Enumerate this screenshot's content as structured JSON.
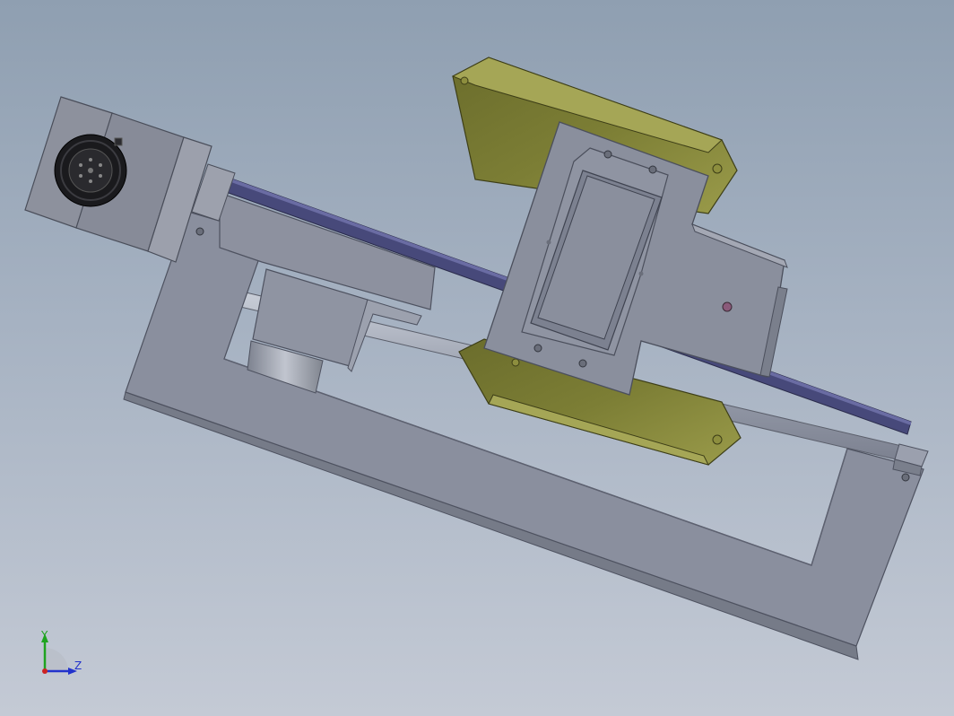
{
  "viewport": {
    "background_top": "#8f9fb1",
    "background_bottom": "#c4cad5"
  },
  "model": {
    "frame_color": "#8a8f9e",
    "rail_color": "#47497a",
    "carriage_plate_color": "#6f7458",
    "motor_color": "#8d919d"
  },
  "triad": {
    "y_label": "Y",
    "z_label": "Z",
    "y_color": "#1fa31f",
    "z_color": "#2233cc",
    "origin_color": "#cc2222"
  }
}
